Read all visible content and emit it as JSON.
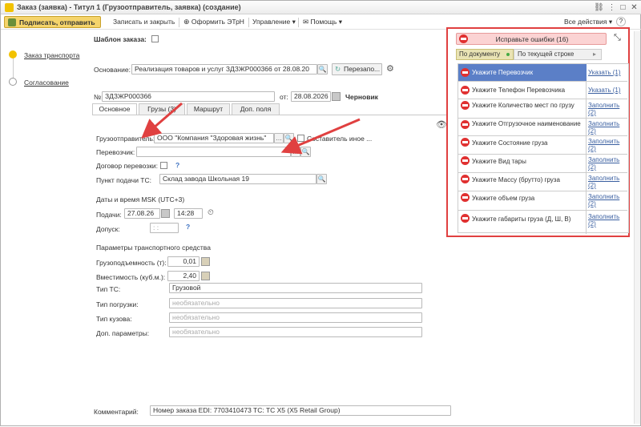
{
  "window": {
    "title": "Заказ (заявка) - Титул 1 (Грузоотправитель, заявка) (создание)"
  },
  "toolbar": {
    "sign_send": "Подписать, отправить",
    "save_close": "Записать и закрыть",
    "etrn": "Оформить ЭТрН",
    "manage": "Управление",
    "help": "Помощь",
    "all_actions": "Все действия",
    "help_q": "?"
  },
  "nav": {
    "order": "Заказ транспорта",
    "approval": "Согласование"
  },
  "form": {
    "template_label": "Шаблон заказа:",
    "basis_label": "Основание:",
    "basis_value": "Реализация товаров и услуг ЗДЗЖР000366 от 28.08.20",
    "repost_btn": "Перезапо...",
    "num_label": "№:",
    "num_value": "ЗДЗЖР000366",
    "from_label": "от:",
    "date_value": "28.08.2026",
    "status": "Черновик"
  },
  "tabs": [
    "Основное",
    "Грузы (3)",
    "Маршрут",
    "Доп. поля"
  ],
  "main": {
    "shipper_label": "Грузоотправитель:",
    "shipper_value": "ООО \"Компания \"Здоровая жизнь\"",
    "other_label": "Составитель иное ...",
    "carrier_label": "Перевозчик:",
    "carrier_value": "",
    "contract_label": "Договор перевозки:",
    "q1": "?",
    "pickup_label": "Пункт подачи ТС:",
    "pickup_value": "Склад завода Школьная 19",
    "datetime_label": "Даты и время MSK (UTC+3)",
    "supply_label": "Подачи:",
    "supply_date": "27.08.26",
    "supply_time": "14:28",
    "admit_label": "Допуск:",
    "admit_value": ":  :",
    "q2": "?",
    "vehicle_params": "Параметры транспортного средства",
    "capacity_label": "Грузоподъемность (т):",
    "capacity_value": "0,01",
    "volume_label": "Вместимость (куб.м.):",
    "volume_value": "2,40",
    "ts_type_label": "Тип ТС:",
    "ts_type_value": "Грузовой",
    "load_type_label": "Тип погрузки:",
    "body_type_label": "Тип кузова:",
    "extra_label": "Доп. параметры:",
    "placeholder": "необязательно",
    "comment_label": "Комментарий:",
    "comment_value": "Номер заказа EDI: 7703410473 TC: TC X5 (X5 Retail Group)"
  },
  "errors_panel": {
    "title": "Исправьте ошибки (16)",
    "by_doc": "По документу",
    "by_row": "По текущей строке",
    "items": [
      {
        "text": "Укажите Перевозчик",
        "action": "Указать (1)"
      },
      {
        "text": "Укажите Телефон Перевозчика",
        "action": "Указать (1)"
      },
      {
        "text": "Укажите Количество мест по грузу",
        "action": "Заполнить (2)"
      },
      {
        "text": "Укажите Отгрузочное наименование",
        "action": "Заполнить (2)"
      },
      {
        "text": "Укажите Состояние груза",
        "action": "Заполнить (2)"
      },
      {
        "text": "Укажите Вид тары",
        "action": "Заполнить (2)"
      },
      {
        "text": "Укажите Массу (брутто) груза",
        "action": "Заполнить (2)"
      },
      {
        "text": "Укажите объем груза",
        "action": "Заполнить (2)"
      },
      {
        "text": "Укажите габариты груза (Д, Ш, В)",
        "action": "Заполнить (2)"
      }
    ]
  },
  "colors": {
    "accent": "#f5d46b",
    "error": "#e04040",
    "selected_row": "#5b7fc7"
  }
}
